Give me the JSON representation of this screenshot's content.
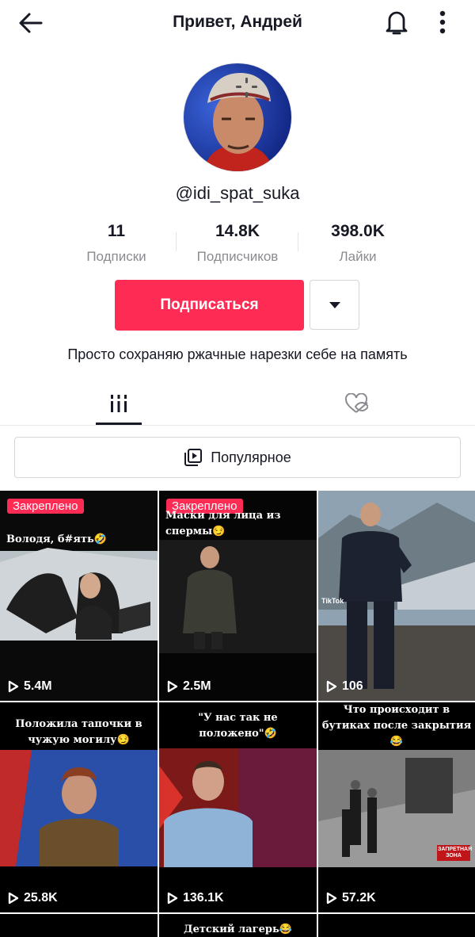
{
  "header": {
    "title": "Привет, Андрей"
  },
  "profile": {
    "username": "@idi_spat_suka",
    "stats": [
      {
        "value": "11",
        "label": "Подписки"
      },
      {
        "value": "14.8K",
        "label": "Подписчиков"
      },
      {
        "value": "398.0K",
        "label": "Лайки"
      }
    ],
    "follow_label": "Подписаться",
    "bio": "Просто сохраняю ржачные нарезки себе на память"
  },
  "filter": {
    "label": "Популярное"
  },
  "videos": [
    {
      "pinned": "Закреплено",
      "caption": "Володя, б#ять🤣",
      "views": "5.4M"
    },
    {
      "pinned": "Закреплено",
      "caption": "Маски для лица из спермы😏",
      "views": "2.5M"
    },
    {
      "pinned": "",
      "caption": "",
      "watermark": "TikTok",
      "views": "106"
    },
    {
      "pinned": "",
      "caption": "Положила тапочки в чужую могилу😏",
      "views": "25.8K"
    },
    {
      "pinned": "",
      "caption": "\"У нас так не положено\"🤣",
      "views": "136.1K"
    },
    {
      "pinned": "",
      "caption": "Что происходит в бутиках после закрытия😂",
      "badge": "ЗАПРЕТНАЯ ЗОНА",
      "views": "57.2K"
    },
    {
      "pinned": "",
      "caption": "",
      "views": ""
    },
    {
      "pinned": "",
      "caption": "Детский лагерь😂",
      "views": ""
    },
    {
      "pinned": "",
      "caption": "",
      "views": ""
    }
  ],
  "colors": {
    "accent": "#fe2c55",
    "text": "#161823",
    "muted": "#8a8b91"
  },
  "icons": [
    "back-arrow-icon",
    "bell-icon",
    "more-vertical-icon",
    "caret-down-icon",
    "grid-icon",
    "liked-hidden-icon",
    "playlist-icon",
    "play-icon"
  ]
}
